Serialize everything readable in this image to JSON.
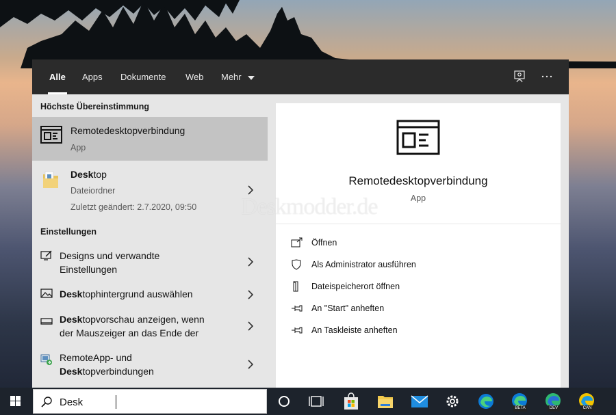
{
  "tabs": [
    "Alle",
    "Apps",
    "Dokumente",
    "Web",
    "Mehr"
  ],
  "watermark": "Deskmodder.de",
  "best_match": {
    "heading": "Höchste Übereinstimmung",
    "title": "Remotedesktopverbindung",
    "subtitle": "App"
  },
  "desktop_item": {
    "title_bold": "Desk",
    "title_rest": "top",
    "type": "Dateiordner",
    "modified": "Zuletzt geändert: 2.7.2020, 09:50"
  },
  "settings": {
    "heading": "Einstellungen",
    "items": [
      {
        "line1": "Designs und verwandte",
        "line2": "Einstellungen"
      },
      {
        "bold": "Desk",
        "rest": "tophintergrund auswählen"
      },
      {
        "bold": "Desk",
        "rest": "topvorschau anzeigen, wenn",
        "line2": "der Mauszeiger an das Ende der"
      },
      {
        "line1": "RemoteApp- und",
        "bold2": "Desk",
        "rest2": "topverbindungen"
      }
    ]
  },
  "preview": {
    "title": "Remotedesktopverbindung",
    "subtitle": "App",
    "actions": [
      "Öffnen",
      "Als Administrator ausführen",
      "Dateispeicherort öffnen",
      "An \"Start\" anheften",
      "An Taskleiste anheften"
    ]
  },
  "search": {
    "value": "Desk"
  },
  "taskbar_icons": [
    "cortana-icon",
    "task-view-icon",
    "store-icon",
    "file-explorer-icon",
    "mail-icon",
    "settings-icon",
    "edge-icon",
    "edge-beta-icon",
    "edge-dev-icon",
    "edge-canary-icon"
  ],
  "edge_badges": [
    "BETA",
    "DEV",
    "CAN"
  ],
  "colors": {
    "taskbar": "#1d232c",
    "topbar": "#2b2b2b",
    "selected": "#c3c3c3",
    "panel": "#e6e6e6"
  }
}
